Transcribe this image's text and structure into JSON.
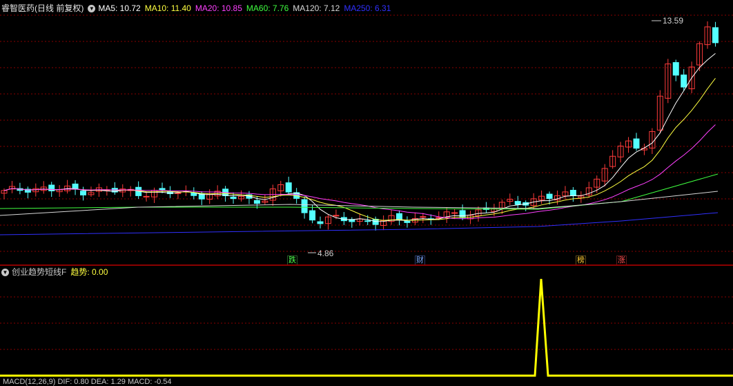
{
  "header": {
    "title": "睿智医药(日线 前复权)",
    "ma": [
      {
        "label": "MA5: 10.72",
        "color": "#ffffff"
      },
      {
        "label": "MA10: 11.40",
        "color": "#ffff40"
      },
      {
        "label": "MA20: 10.85",
        "color": "#ff40ff"
      },
      {
        "label": "MA60: 7.76",
        "color": "#40ff40"
      },
      {
        "label": "MA120: 7.12",
        "color": "#d8d8d8"
      },
      {
        "label": "MA250: 6.31",
        "color": "#3030ff"
      }
    ]
  },
  "price": {
    "high_label": "13.59",
    "low_label": "4.86",
    "markers": [
      "跌",
      "财",
      "榜",
      "涨"
    ]
  },
  "indicator": {
    "title": "创业趋势短线F",
    "trend_label": "趋势: 0.00"
  },
  "footer": {
    "text": "MACD(12,26,9)  DIF: 0.80  DEA: 1.29  MACD: -0.54"
  },
  "colors": {
    "up": "#ff3b3b",
    "down": "#54ffff",
    "grid": "#8b0000",
    "trend": "#ffff00"
  }
}
